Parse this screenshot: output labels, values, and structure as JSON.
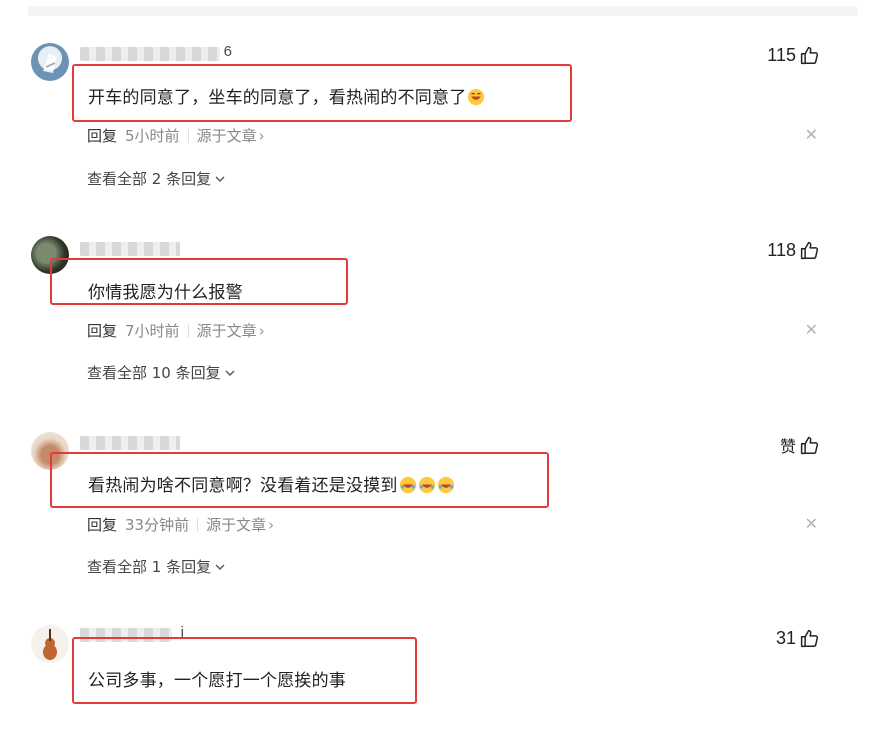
{
  "comments": [
    {
      "username_tail": "6",
      "likes": "115",
      "text": "开车的同意了，坐车的同意了，看热闹的不同意了",
      "reply_label": "回复",
      "time": "5小时前",
      "source": "源于文章",
      "view_replies": "查看全部 2 条回复"
    },
    {
      "username_tail": "",
      "likes": "118",
      "text": "你情我愿为什么报警",
      "reply_label": "回复",
      "time": "7小时前",
      "source": "源于文章",
      "view_replies": "查看全部 10 条回复"
    },
    {
      "username_tail": "",
      "likes": "赞",
      "text": "看热闹为啥不同意啊？没看着还是没摸到",
      "reply_label": "回复",
      "time": "33分钟前",
      "source": "源于文章",
      "view_replies": "查看全部 1 条回复"
    },
    {
      "username_tail": "i",
      "likes": "31",
      "text": "公司多事，一个愿打一个愿挨的事"
    }
  ],
  "colors": {
    "highlight_box": "#e23b3b",
    "meta_text": "#888888",
    "body_text": "#222222"
  },
  "icons": {
    "like": "thumbs-up-icon",
    "close": "close-icon",
    "chevron": "chevron-down-icon",
    "emoji": "laughing-emoji-icon"
  }
}
